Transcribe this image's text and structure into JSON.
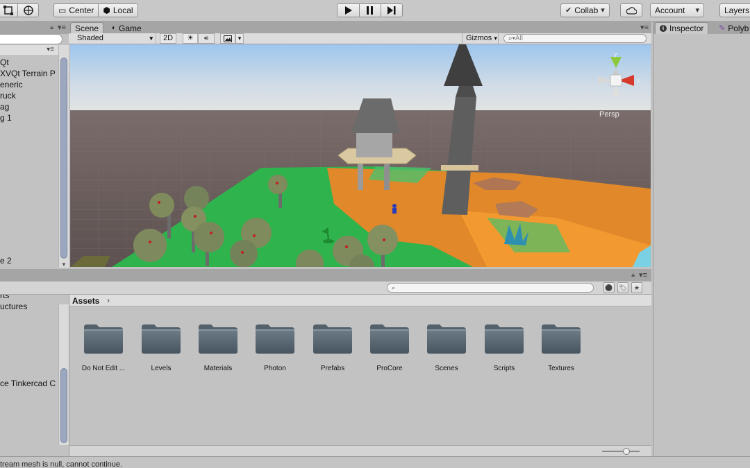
{
  "toolbar": {
    "center_label": "Center",
    "local_label": "Local",
    "collab_label": "Collab",
    "account_label": "Account",
    "layers_label": "Layers"
  },
  "hierarchy": {
    "items": [
      "Qt",
      "XVQt Terrain P",
      "eneric",
      "ruck",
      "ag",
      "g 1"
    ],
    "bottom_item": "e 2"
  },
  "scene_tabs": {
    "scene": "Scene",
    "game": "Game"
  },
  "scene_toolbar": {
    "shading_mode": "Shaded",
    "toggle_2d": "2D",
    "gizmos_label": "Gizmos",
    "search_placeholder": "All"
  },
  "scene_gizmo": {
    "projection": "Persp",
    "axis_y": "y",
    "axis_x": "x"
  },
  "inspector": {
    "tab_label": "Inspector",
    "tab2_label": "Polyb"
  },
  "project": {
    "sidebar_items": [
      "rts",
      "uctures",
      "ce Tinkercad C"
    ],
    "breadcrumb": "Assets",
    "folders": [
      "Do Not Edit ...",
      "Levels",
      "Materials",
      "Photon",
      "Prefabs",
      "ProCore",
      "Scenes",
      "Scripts",
      "Textures"
    ]
  },
  "status_bar": {
    "message": "tream mesh is null, cannot continue."
  }
}
